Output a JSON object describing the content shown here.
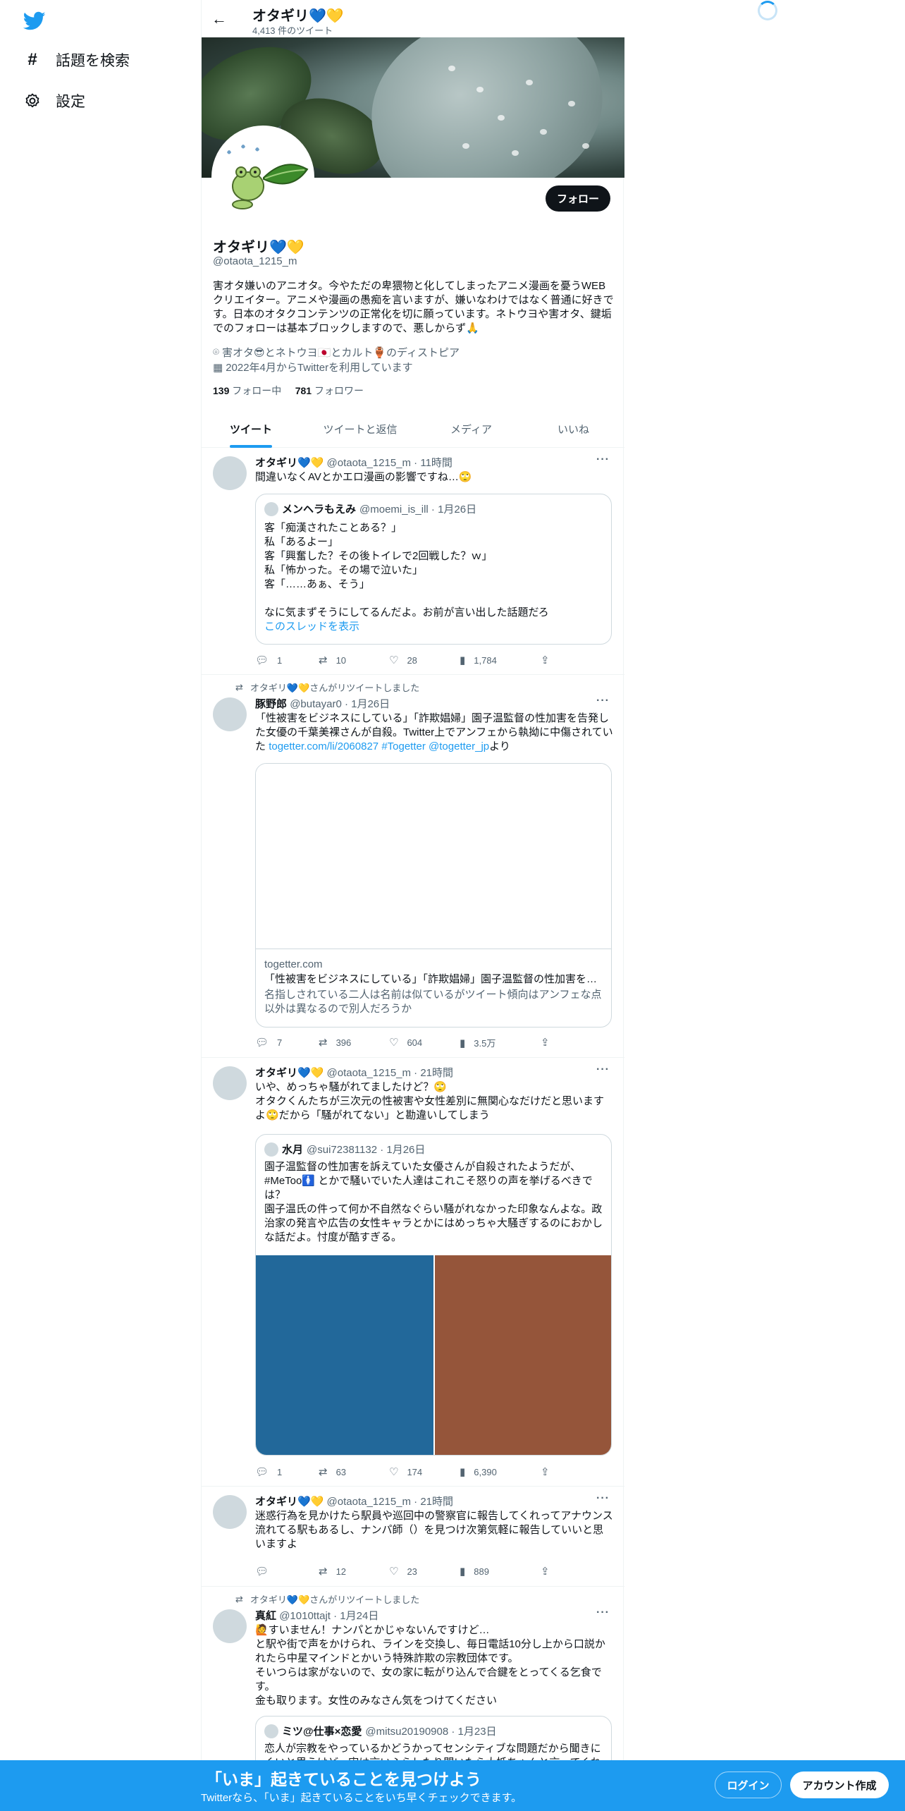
{
  "sidebar": {
    "items": [
      {
        "icon": "hashtag-icon",
        "label": "話題を検索"
      },
      {
        "icon": "gear-icon",
        "label": "設定"
      }
    ]
  },
  "header": {
    "name": "オタギリ💙💛",
    "tweet_count": "4,413 件のツイート"
  },
  "profile": {
    "follow_label": "フォロー",
    "name": "オタギリ💙💛",
    "handle": "@otaota_1215_m",
    "bio": "害オタ嫌いのアニオタ。今やただの卑猥物と化してしまったアニメ漫画を憂うWEBクリエイター。アニメや漫画の愚痴を言いますが、嫌いなわけではなく普通に好きです。日本のオタクコンテンツの正常化を切に願っています。ネトウヨや害オタ、鍵垢でのフォローは基本ブロックしますので、悪しからず🙏",
    "location": "害オタ😎とネトウヨ🇯🇵とカルト🏺のディストピア",
    "joined": "2022年4月からTwitterを利用しています",
    "following_count": "139",
    "following_label": "フォロー中",
    "followers_count": "781",
    "followers_label": "フォロワー"
  },
  "tabs": [
    "ツイート",
    "ツイートと返信",
    "メディア",
    "いいね"
  ],
  "tweets": [
    {
      "author": "オタギリ💙💛",
      "meta": "@otaota_1215_m · 11時間",
      "text": "間違いなくAVとかエロ漫画の影響ですね…🙄",
      "quote": {
        "author": "メンヘラもえみ",
        "meta": "@moemi_is_ill · 1月26日",
        "lines": [
          "客「痴漢されたことある？」",
          "私「あるよー」",
          "客「興奮した？その後トイレで2回戦した？ｗ」",
          "私「怖かった。その場で泣いた」",
          "客「……あぁ、そう」",
          "",
          "なに気まずそうにしてるんだよ。お前が言い出した話題だろ"
        ],
        "thread_link": "このスレッドを表示"
      },
      "stats": {
        "reply": "1",
        "retweet": "10",
        "like": "28",
        "views": "1,784"
      }
    },
    {
      "rt_by": "オタギリ💙💛さんがリツイートしました",
      "author": "豚野郎",
      "meta": "@butayar0 · 1月26日",
      "text": "「性被害をビジネスにしている」「詐欺娼婦」園子温監督の性加害を告発した女優の千葉美裸さんが自殺。Twitter上でアンフェから執拗に中傷されていた",
      "links": [
        "togetter.com/li/2060827",
        "#Togetter",
        "@togetter_jp"
      ],
      "text_tail": "より",
      "card": {
        "domain": "togetter.com",
        "title": "「性被害をビジネスにしている」「詐欺娼婦」園子温監督の性加害を…",
        "desc": "名指しされている二人は名前は似ているがツイート傾向はアンフェな点以外は異なるので別人だろうか"
      },
      "stats": {
        "reply": "7",
        "retweet": "396",
        "like": "604",
        "views": "3.5万"
      }
    },
    {
      "author": "オタギリ💙💛",
      "meta": "@otaota_1215_m · 21時間",
      "text": "いや、めっちゃ騒がれてましたけど？🙄\nオタクくんたちが三次元の性被害や女性差別に無関心なだけだと思いますよ🙄だから「騒がれてない」と勘違いしてしまう",
      "quote": {
        "author": "水月",
        "meta": "@sui72381132 · 1月26日",
        "text": "園子温監督の性加害を訴えていた女優さんが自殺されたようだが、#MeToo🚺 とかで騒いでいた人達はこれこそ怒りの声を挙げるべきでは？\n園子温氏の件って何か不自然なぐらい騒がれなかった印象なんよな。政治家の発言や広告の女性キャラとかにはめっちゃ大騒ぎするのにおかしな話だよ。忖度が酷すぎる。",
        "image_colors": [
          "#22689a",
          "#95553a"
        ]
      },
      "stats": {
        "reply": "1",
        "retweet": "63",
        "like": "174",
        "views": "6,390"
      }
    },
    {
      "author": "オタギリ💙💛",
      "meta": "@otaota_1215_m · 21時間",
      "text": "迷惑行為を見かけたら駅員や巡回中の警察官に報告してくれってアナウンス流れてる駅もあるし、ナンパ師（）を見つけ次第気軽に報告していいと思いますよ",
      "stats": {
        "reply": "",
        "retweet": "12",
        "like": "23",
        "views": "889"
      }
    },
    {
      "rt_by": "オタギリ💙💛さんがリツイートしました",
      "author": "真紅",
      "meta": "@1010ttajt · 1月24日",
      "text": "🙋すいません！ナンパとかじゃないんですけど…\nと駅や街で声をかけられ、ラインを交換し、毎日電話10分し上から口説かれたら中星マインドとかいう特殊詐欺の宗教団体です。\nそいつらは家がないので、女の家に転がり込んで合鍵をとってくる乞食です。\n金も取ります。女性のみなさん気をつけてください",
      "quote": {
        "author": "ミツ@仕事×恋愛",
        "meta": "@mitsu20190908 · 1月23日",
        "text": "恋人が宗教をやっているかどうかってセンシティブな問題だから聞きにくいと思うけど、実は言いふらしたり聞いたら大抵ちゃんと言ってくれるよ。"
      }
    }
  ],
  "bottom_bar": {
    "title": "「いま」起きていることを見つけよう",
    "subtitle": "Twitterなら、「いま」起きていることをいち早くチェックできます。",
    "login": "ログイン",
    "signup": "アカウント作成"
  },
  "colors": {
    "accent": "#1d9bf0",
    "text": "#0f1419",
    "muted": "#536471"
  }
}
